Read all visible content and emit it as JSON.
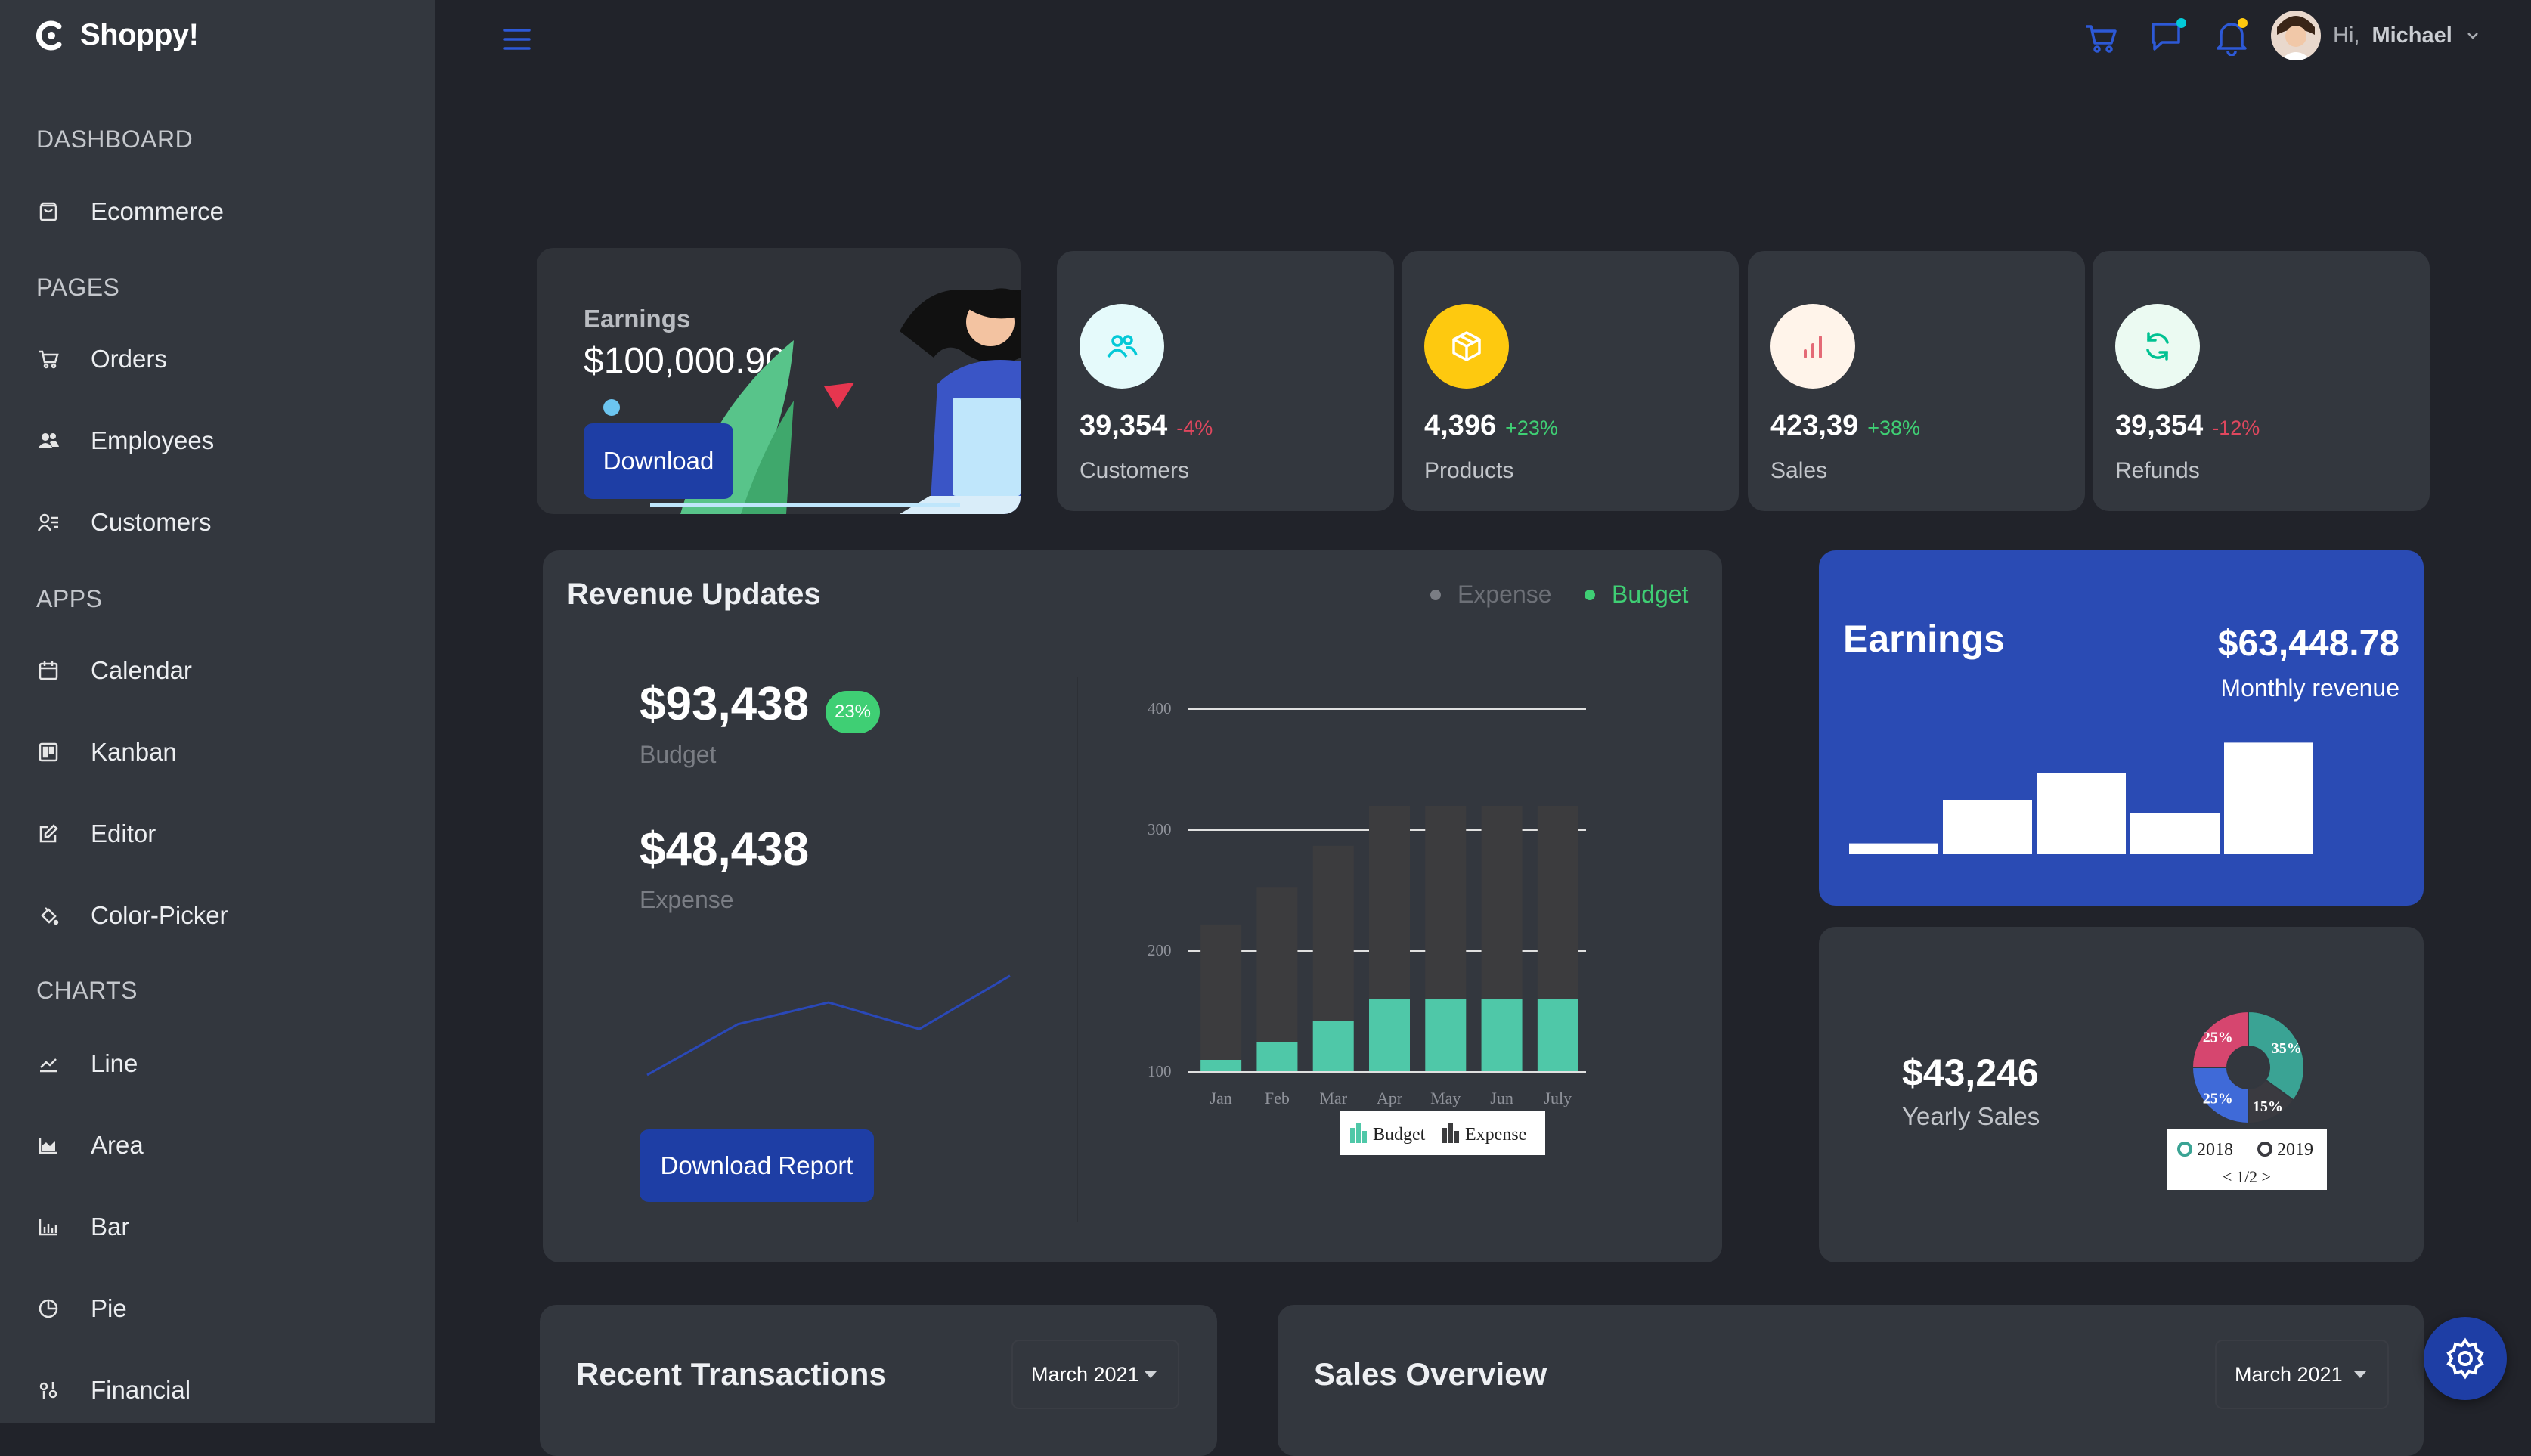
{
  "app": {
    "brand": "Shoppy!"
  },
  "sidebar": {
    "sections": [
      {
        "title": "DASHBOARD",
        "items": [
          {
            "label": "Ecommerce",
            "icon": "shopping-bag-icon"
          }
        ]
      },
      {
        "title": "PAGES",
        "items": [
          {
            "label": "Orders",
            "icon": "cart-icon"
          },
          {
            "label": "Employees",
            "icon": "people-icon"
          },
          {
            "label": "Customers",
            "icon": "contact-list-icon"
          }
        ]
      },
      {
        "title": "APPS",
        "items": [
          {
            "label": "Calendar",
            "icon": "calendar-icon"
          },
          {
            "label": "Kanban",
            "icon": "kanban-icon"
          },
          {
            "label": "Editor",
            "icon": "edit-icon"
          },
          {
            "label": "Color-Picker",
            "icon": "paint-bucket-icon"
          }
        ]
      },
      {
        "title": "CHARTS",
        "items": [
          {
            "label": "Line",
            "icon": "line-chart-icon"
          },
          {
            "label": "Area",
            "icon": "area-chart-icon"
          },
          {
            "label": "Bar",
            "icon": "bar-chart-icon"
          },
          {
            "label": "Pie",
            "icon": "pie-chart-icon"
          },
          {
            "label": "Financial",
            "icon": "financial-icon"
          }
        ]
      }
    ]
  },
  "header": {
    "greeting": "Hi,",
    "user_name": "Michael",
    "icons": [
      "menu-icon",
      "cart-icon",
      "chat-icon",
      "bell-icon",
      "avatar",
      "chevron-down-icon"
    ],
    "accent": "#1e3ea5"
  },
  "earnings_card": {
    "title": "Earnings",
    "amount": "$100,000.90",
    "button": "Download"
  },
  "stats": [
    {
      "value": "39,354",
      "change": "-4%",
      "trend": "down",
      "label": "Customers",
      "icon": "customers-icon",
      "circle_color": "#e5fafb",
      "icon_color": "#03c9d7"
    },
    {
      "value": "4,396",
      "change": "+23%",
      "trend": "up",
      "label": "Products",
      "icon": "box-icon",
      "circle_color": "#fec90f",
      "icon_color": "#ffffff"
    },
    {
      "value": "423,39",
      "change": "+38%",
      "trend": "up",
      "label": "Sales",
      "icon": "bar-chart-icon",
      "circle_color": "#fff4ea",
      "icon_color": "#e46a76"
    },
    {
      "value": "39,354",
      "change": "-12%",
      "trend": "down",
      "label": "Refunds",
      "icon": "refresh-icon",
      "circle_color": "#ebfaf2",
      "icon_color": "#00c292"
    }
  ],
  "revenue": {
    "title": "Revenue Updates",
    "legend": [
      "Expense",
      "Budget"
    ],
    "budget_value": "$93,438",
    "budget_badge": "23%",
    "budget_label": "Budget",
    "expense_value": "$48,438",
    "expense_label": "Expense",
    "button": "Download Report",
    "sparkline": [
      0,
      42,
      60,
      38,
      82
    ]
  },
  "chart_data": [
    {
      "type": "bar",
      "stacked": true,
      "categories": [
        "Jan",
        "Feb",
        "Mar",
        "Apr",
        "May",
        "Jun",
        "July"
      ],
      "series": [
        {
          "name": "Budget",
          "values": [
            110,
            125,
            142,
            160,
            160,
            160,
            160
          ],
          "color": "#4fc8a8"
        },
        {
          "name": "Expense",
          "values": [
            222,
            253,
            287,
            320,
            320,
            320,
            320
          ],
          "color": "#3c3c3e"
        }
      ],
      "ylim": [
        100,
        400
      ],
      "yticks": [
        100,
        200,
        300,
        400
      ],
      "legend_position": "bottom"
    },
    {
      "type": "pie",
      "labels": [
        "25%",
        "35%",
        "15%",
        "25%"
      ],
      "values": [
        25,
        35,
        15,
        25
      ],
      "colors": [
        "#d6466f",
        "#3aa394",
        "#3a3a40",
        "#3f6ad8"
      ],
      "legend": [
        "2018",
        "2019"
      ],
      "legend_page": "1/2"
    }
  ],
  "earnings_blue": {
    "title": "Earnings",
    "amount": "$63,448.78",
    "subtitle": "Monthly revenue",
    "bars": [
      8,
      40,
      60,
      30,
      82
    ],
    "bg": "#2a4bb4"
  },
  "yearly": {
    "value": "$43,246",
    "label": "Yearly Sales"
  },
  "recent": {
    "title": "Recent Transactions",
    "dropdown": "March 2021"
  },
  "overview": {
    "title": "Sales Overview",
    "dropdown": "March 2021"
  }
}
